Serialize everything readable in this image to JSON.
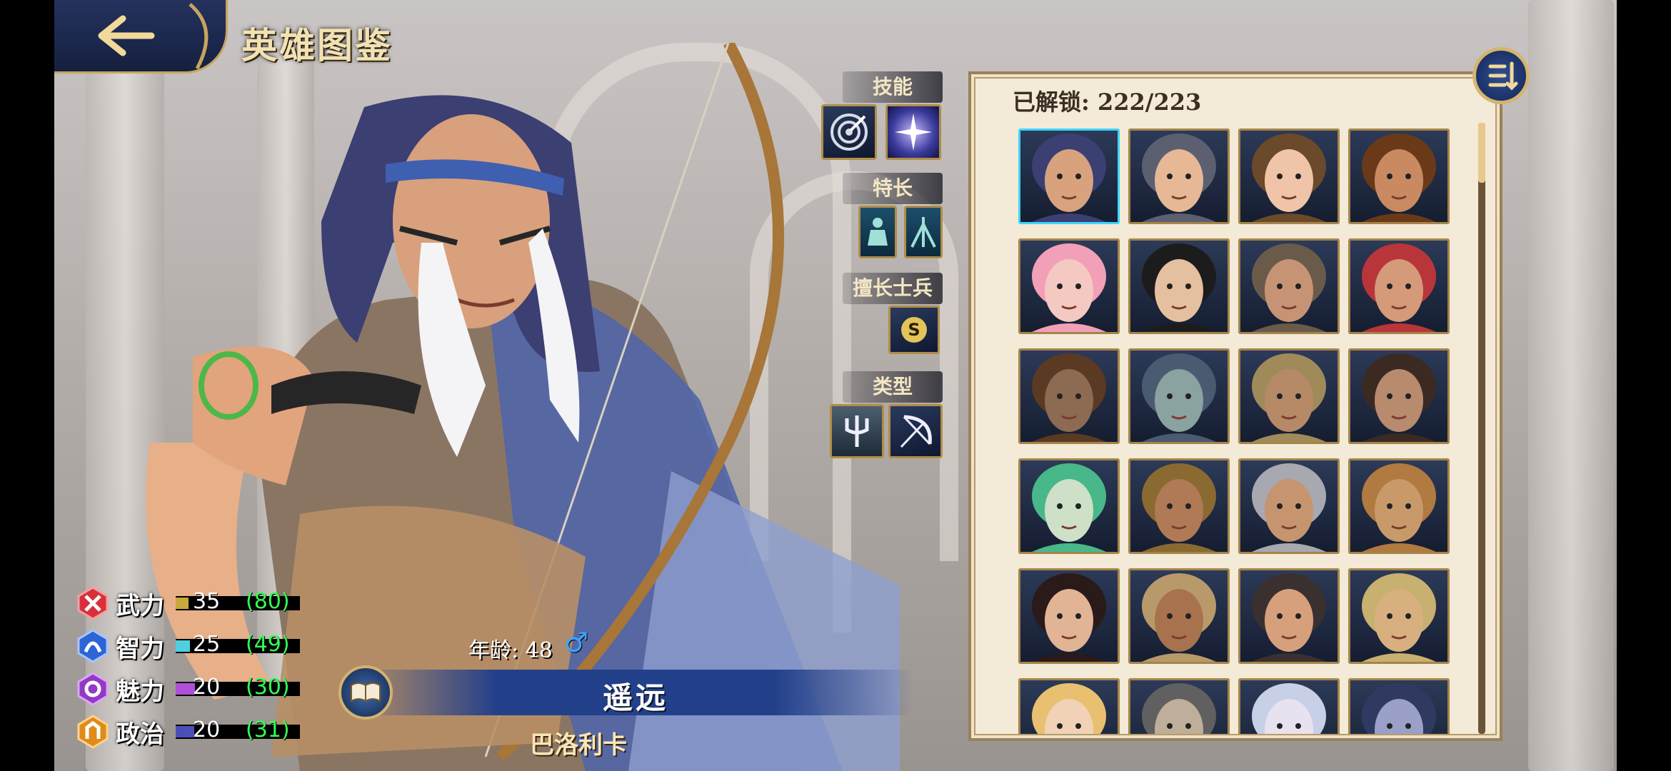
{
  "header": {
    "title": "英雄图鉴",
    "back_icon": "back-arrow-icon"
  },
  "sections": {
    "skill_label": "技能",
    "specialty_label": "特长",
    "troop_label": "擅长士兵",
    "type_label": "类型",
    "troop_badge": "S"
  },
  "stats": [
    {
      "label": "武力",
      "value": "35",
      "max": "(80)",
      "fraction": 0.44,
      "color": "#c8a83a",
      "icon": "force-icon"
    },
    {
      "label": "智力",
      "value": "25",
      "max": "(49)",
      "fraction": 0.51,
      "color": "#4fd0e0",
      "icon": "intelligence-icon"
    },
    {
      "label": "魅力",
      "value": "20",
      "max": "(30)",
      "fraction": 0.67,
      "color": "#b04fd8",
      "icon": "charm-icon"
    },
    {
      "label": "政治",
      "value": "20",
      "max": "(31)",
      "fraction": 0.65,
      "color": "#4a4fb8",
      "icon": "politics-icon"
    }
  ],
  "hero": {
    "age_text": "年龄: 48",
    "gender_symbol": "♂",
    "title": "遥远",
    "name": "巴洛利卡"
  },
  "panel": {
    "unlock_text": "已解锁: 222/223",
    "scroll_fraction": 0.0
  },
  "colors": {
    "accent_gold": "#c7a45f",
    "panel_bg": "#f3ead7",
    "banner_blue": "#23408a",
    "selected_border": "#3fd4ff"
  }
}
